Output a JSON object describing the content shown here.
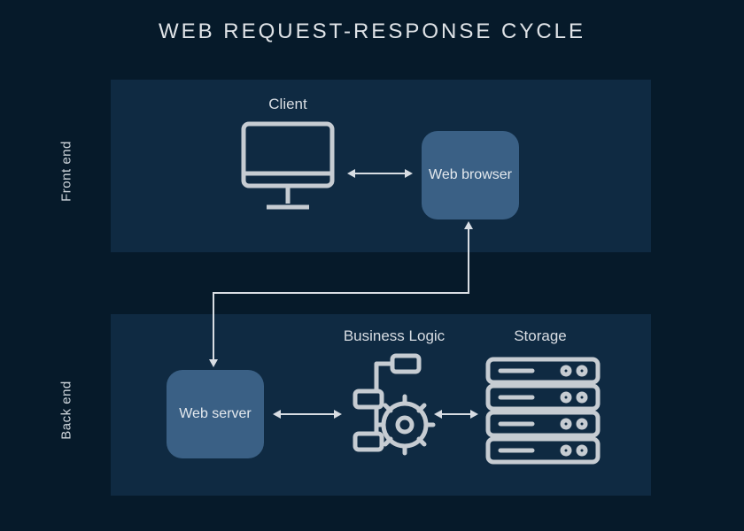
{
  "title": "WEB REQUEST-RESPONSE CYCLE",
  "sections": {
    "frontend": {
      "label": "Front end"
    },
    "backend": {
      "label": "Back end"
    }
  },
  "nodes": {
    "client": {
      "label": "Client"
    },
    "browser": {
      "label": "Web browser"
    },
    "server": {
      "label": "Web server"
    },
    "business_logic": {
      "label": "Business Logic"
    },
    "storage": {
      "label": "Storage"
    }
  }
}
